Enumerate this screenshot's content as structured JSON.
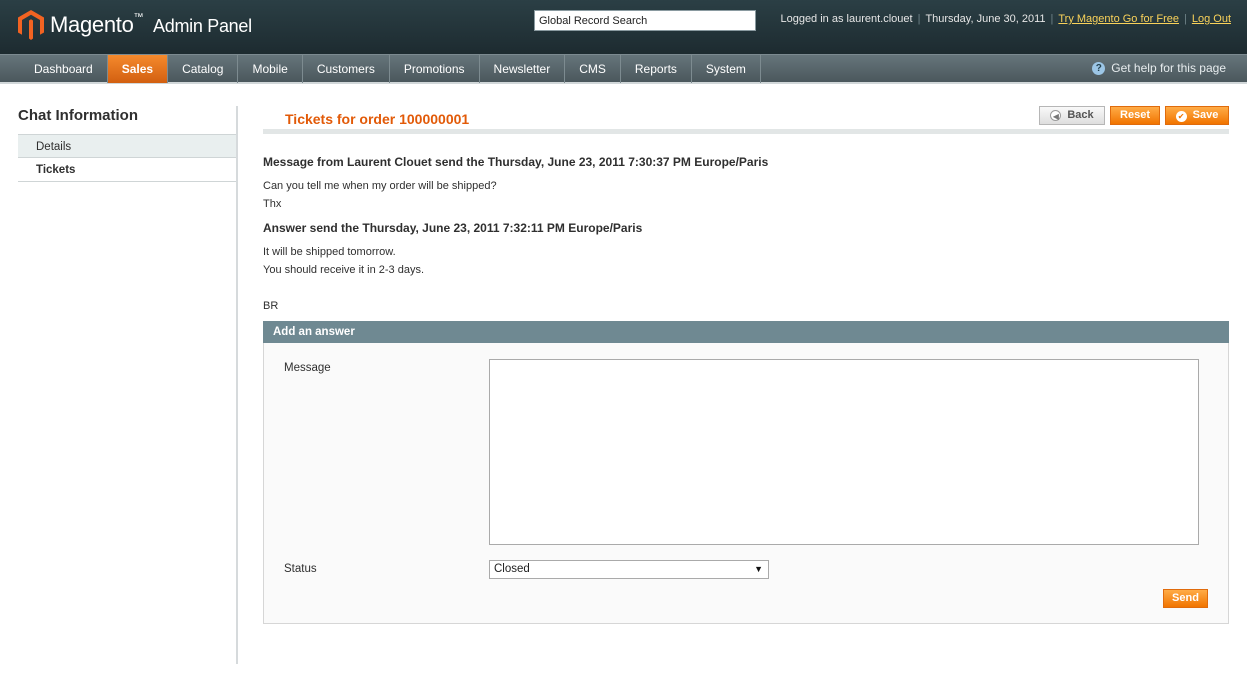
{
  "header": {
    "logo_text": "Magento",
    "logo_tm": "™",
    "logo_sub": "Admin Panel",
    "search_value": "Global Record Search",
    "logged_in": "Logged in as laurent.clouet",
    "date": "Thursday, June 30, 2011",
    "try_link": "Try Magento Go for Free",
    "logout": "Log Out"
  },
  "nav": {
    "items": [
      "Dashboard",
      "Sales",
      "Catalog",
      "Mobile",
      "Customers",
      "Promotions",
      "Newsletter",
      "CMS",
      "Reports",
      "System"
    ],
    "active": "Sales",
    "help": "Get help for this page"
  },
  "sidebar": {
    "title": "Chat Information",
    "tabs": [
      "Details",
      "Tickets"
    ]
  },
  "main": {
    "title": "Tickets for order 100000001",
    "buttons": {
      "back": "Back",
      "reset": "Reset",
      "save": "Save"
    },
    "messages": {
      "q_head": "Message from Laurent Clouet send the Thursday, June 23, 2011 7:30:37 PM Europe/Paris",
      "q_line1": "Can you tell me when my order will be shipped?",
      "q_line2": "Thx",
      "a_head": "Answer send the Thursday, June 23, 2011 7:32:11 PM Europe/Paris",
      "a_line1": "It will be shipped tomorrow.",
      "a_line2": "You should receive it in 2-3 days.",
      "a_line3": "BR"
    },
    "answer_form": {
      "legend": "Add an answer",
      "message_label": "Message",
      "message_value": "",
      "status_label": "Status",
      "status_value": "Closed",
      "send": "Send"
    }
  },
  "colors": {
    "accent": "#e25a08",
    "header": "#1d2b30",
    "nav": "#4b575c",
    "fieldset_head": "#6f8992"
  },
  "icons": {
    "logo": "magento-logo-icon",
    "help": "help-icon",
    "back": "back-arrow-icon",
    "save": "check-icon",
    "select": "dropdown-arrow-icon"
  }
}
